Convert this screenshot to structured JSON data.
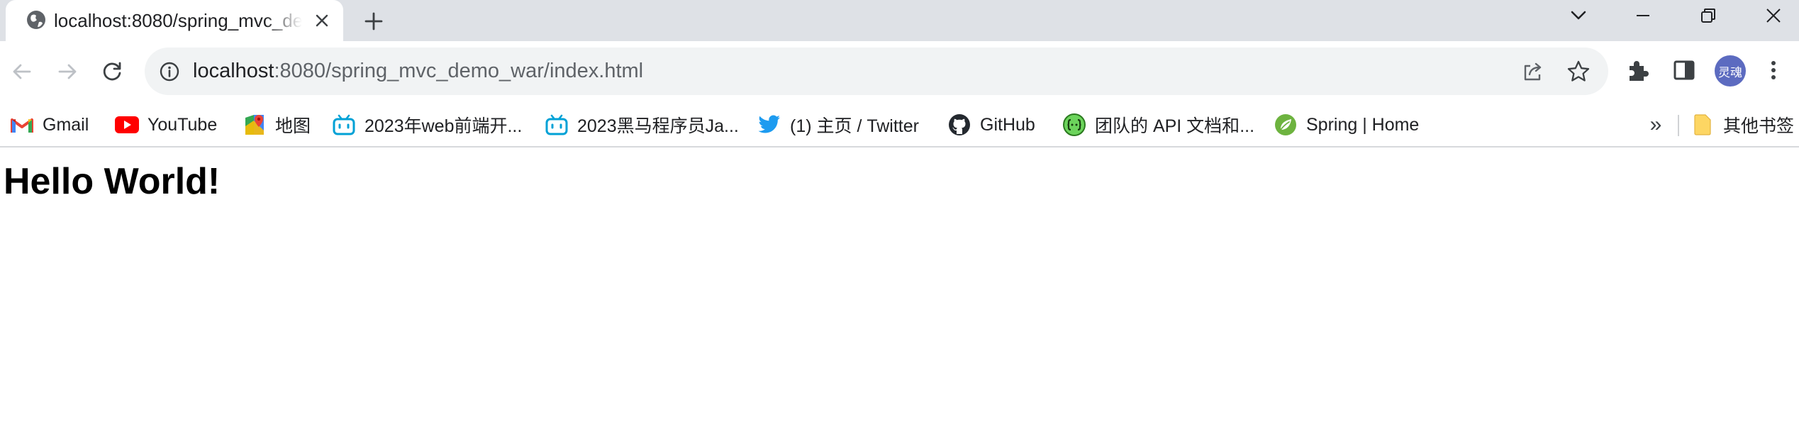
{
  "tab": {
    "title": "localhost:8080/spring_mvc_demo_war/index.html",
    "favicon": "globe-icon"
  },
  "window_controls": [
    "tab-search-icon",
    "minimize-icon",
    "restore-icon",
    "close-icon"
  ],
  "toolbar": {
    "back": "back-arrow-icon",
    "forward": "forward-arrow-icon",
    "reload": "reload-icon"
  },
  "address_bar": {
    "host": "localhost",
    "rest": ":8080/spring_mvc_demo_war/index.html"
  },
  "profile": {
    "avatar_text": "灵魂",
    "avatar_color": "#5c6bc0"
  },
  "bookmarks": {
    "items": [
      {
        "label": "Gmail",
        "icon": "gmail-icon"
      },
      {
        "label": "YouTube",
        "icon": "youtube-icon"
      },
      {
        "label": "地图",
        "icon": "maps-icon"
      },
      {
        "label": "2023年web前端开...",
        "icon": "bilibili-icon"
      },
      {
        "label": "2023黑马程序员Ja...",
        "icon": "bilibili-icon"
      },
      {
        "label": "(1) 主页 / Twitter",
        "icon": "twitter-icon"
      },
      {
        "label": "GitHub",
        "icon": "github-icon"
      },
      {
        "label": "团队的 API 文档和...",
        "icon": "api-docs-icon"
      },
      {
        "label": "Spring | Home",
        "icon": "spring-icon"
      }
    ],
    "more_label": "»",
    "other_folder_label": "其他书签"
  },
  "page": {
    "heading": "Hello World!"
  }
}
